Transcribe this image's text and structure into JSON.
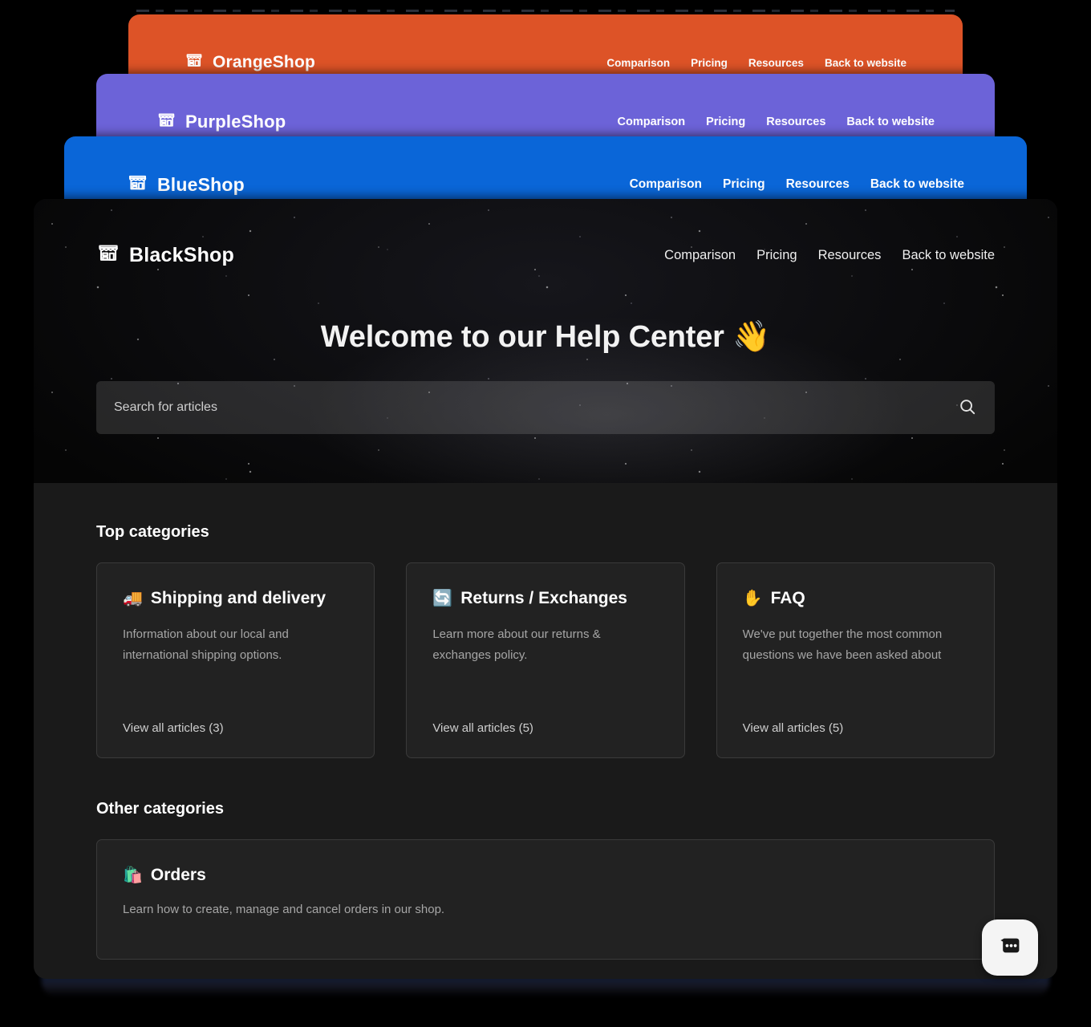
{
  "layers": [
    {
      "brand": "OrangeShop",
      "color": "#DD5327",
      "logo_icon": "storefront-icon",
      "nav": [
        "Comparison",
        "Pricing",
        "Resources",
        "Back to website"
      ]
    },
    {
      "brand": "PurpleShop",
      "color": "#6C63D8",
      "logo_icon": "storefront-icon",
      "nav": [
        "Comparison",
        "Pricing",
        "Resources",
        "Back to website"
      ]
    },
    {
      "brand": "BlueShop",
      "color": "#0A66D8",
      "logo_icon": "storefront-icon",
      "nav": [
        "Comparison",
        "Pricing",
        "Resources",
        "Back to website"
      ]
    }
  ],
  "main": {
    "brand": "BlackShop",
    "color": "#1A1A1A",
    "logo_icon": "storefront-icon",
    "nav": [
      "Comparison",
      "Pricing",
      "Resources",
      "Back to website"
    ],
    "hero": {
      "title": "Welcome to our Help Center 👋",
      "search_placeholder": "Search for articles",
      "search_value": "",
      "search_icon": "search-icon"
    },
    "top_categories": {
      "heading": "Top categories",
      "cards": [
        {
          "emoji": "🚚",
          "emoji_name": "delivery-truck-icon",
          "title": "Shipping and delivery",
          "description": "Information about our local and international shipping options.",
          "link": "View all articles (3)",
          "count": 3
        },
        {
          "emoji": "🔄",
          "emoji_name": "refresh-arrows-icon",
          "title": "Returns / Exchanges",
          "description": "Learn more about our returns & exchanges policy.",
          "link": "View all articles (5)",
          "count": 5
        },
        {
          "emoji": "✋",
          "emoji_name": "raised-hand-icon",
          "title": "FAQ",
          "description": "We've put together the most common questions we have been asked about",
          "link": "View all articles (5)",
          "count": 5
        }
      ]
    },
    "other_categories": {
      "heading": "Other categories",
      "cards": [
        {
          "emoji": "🛍️",
          "emoji_name": "shopping-bags-icon",
          "title": "Orders",
          "description": "Learn how to create, manage and cancel orders in our shop."
        }
      ]
    },
    "chat_widget": {
      "icon": "chat-bubble-icon",
      "label": "Open chat"
    }
  }
}
